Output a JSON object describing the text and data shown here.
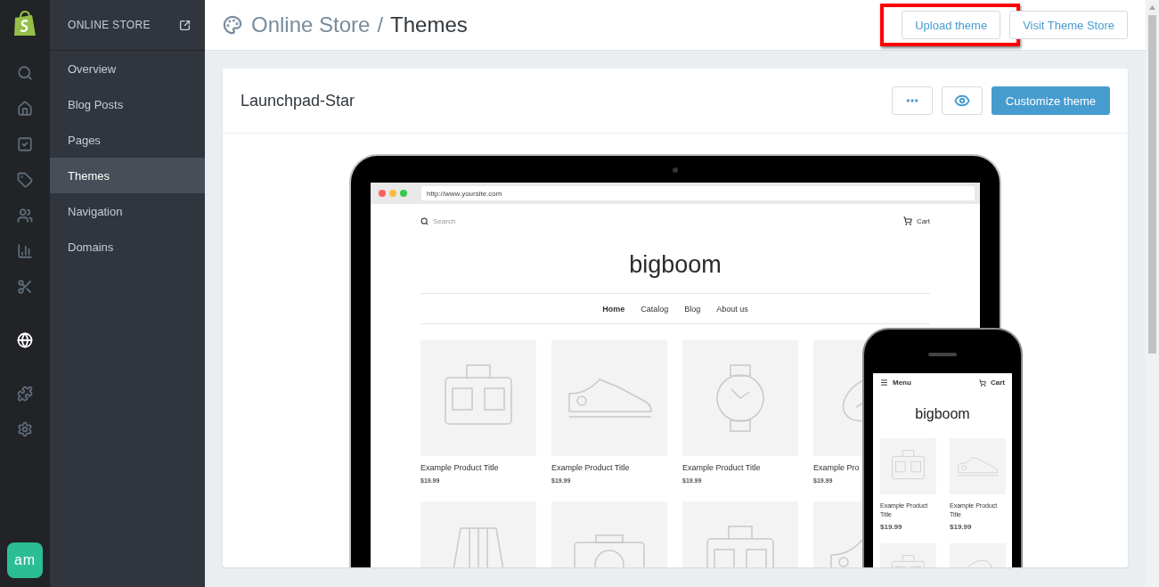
{
  "rail": {
    "items": [
      {
        "kind": "search",
        "selected": false
      },
      {
        "kind": "home",
        "selected": false
      },
      {
        "kind": "orders",
        "selected": false
      },
      {
        "kind": "tag",
        "selected": false
      },
      {
        "kind": "customers",
        "selected": false
      },
      {
        "kind": "reports",
        "selected": false
      },
      {
        "kind": "discounts",
        "selected": false
      },
      {
        "kind": "store",
        "selected": true
      },
      {
        "kind": "apps",
        "selected": false
      },
      {
        "kind": "settings",
        "selected": false
      }
    ],
    "avatar": "am"
  },
  "sidebar": {
    "title": "ONLINE STORE",
    "items": [
      {
        "label": "Overview",
        "selected": false
      },
      {
        "label": "Blog Posts",
        "selected": false
      },
      {
        "label": "Pages",
        "selected": false
      },
      {
        "label": "Themes",
        "selected": true
      },
      {
        "label": "Navigation",
        "selected": false
      },
      {
        "label": "Domains",
        "selected": false
      }
    ]
  },
  "header": {
    "breadcrumb": "Online Store",
    "separator": "/",
    "title": "Themes",
    "buttons": [
      {
        "label": "Upload theme",
        "highlighted": true
      },
      {
        "label": "Visit Theme Store",
        "highlighted": false
      }
    ]
  },
  "theme": {
    "name": "Launchpad-Star",
    "primary_button": "Customize theme",
    "preview": {
      "url": "http://www.yoursite.com",
      "search_placeholder": "Search",
      "cart": "Cart",
      "logo": "bigboom",
      "nav": [
        {
          "label": "Home",
          "selected": true
        },
        {
          "label": "Catalog",
          "selected": false
        },
        {
          "label": "Blog",
          "selected": false
        },
        {
          "label": "About us",
          "selected": false
        }
      ],
      "products": [
        {
          "title": "Example Product Title",
          "price": "$19.99"
        },
        {
          "title": "Example Product Title",
          "price": "$19.99"
        },
        {
          "title": "Example Product Title",
          "price": "$19.99"
        },
        {
          "title": "Example Pro",
          "price": "$19.99"
        }
      ],
      "phone": {
        "menu": "Menu",
        "cart": "Cart",
        "logo": "bigboom",
        "products": [
          {
            "title": "Example Product Title",
            "price": "$19.99"
          },
          {
            "title": "Example Product Title",
            "price": "$19.99"
          }
        ]
      }
    }
  }
}
